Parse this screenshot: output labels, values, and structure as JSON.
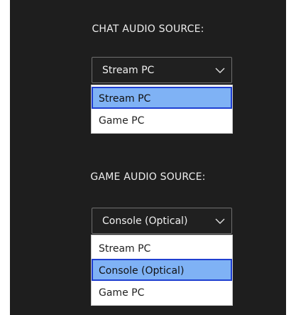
{
  "chat": {
    "label": "CHAT AUDIO SOURCE:",
    "selected": "Stream PC",
    "options": [
      "Stream PC",
      "Game PC"
    ],
    "highlighted_index": 0
  },
  "game": {
    "label": "GAME AUDIO SOURCE:",
    "selected": "Console (Optical)",
    "options": [
      "Stream PC",
      "Console (Optical)",
      "Game PC"
    ],
    "highlighted_index": 1
  },
  "icons": {
    "dropdown": "chevron-down-icon"
  },
  "colors": {
    "panel_bg": "#1e1e1e",
    "option_highlight": "#7fb2f5",
    "option_highlight_border": "#1f3fd1"
  }
}
